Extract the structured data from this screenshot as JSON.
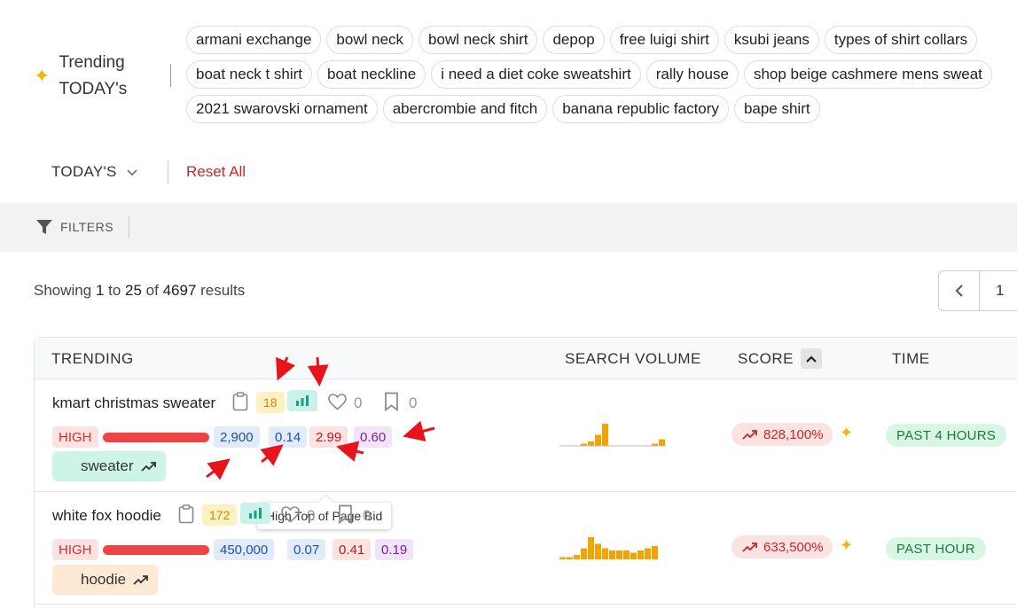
{
  "trending_today": {
    "title_line1": "Trending",
    "title_line2": "TODAY's",
    "chips": [
      [
        "armani exchange",
        "bowl neck",
        "bowl neck shirt",
        "depop",
        "free luigi shirt",
        "ksubi jeans",
        "types of shirt collars"
      ],
      [
        "boat neck t shirt",
        "boat neckline",
        "i need a diet coke sweatshirt",
        "rally house",
        "shop beige cashmere mens sweat"
      ],
      [
        "2021 swarovski ornament",
        "abercrombie and fitch",
        "banana republic factory",
        "bape shirt"
      ]
    ]
  },
  "period_select": {
    "label": "TODAY'S"
  },
  "reset_label": "Reset All",
  "filters_label": "FILTERS",
  "results": {
    "prefix": "Showing ",
    "from": "1",
    "mid1": " to ",
    "to": "25",
    "mid2": " of ",
    "total": "4697",
    "suffix": " results"
  },
  "pagination": {
    "current_page": "1"
  },
  "table": {
    "headers": {
      "trending": "TRENDING",
      "search_volume": "SEARCH VOLUME",
      "score": "SCORE",
      "time": "TIME"
    },
    "rows": [
      {
        "keyword": "kmart christmas sweater",
        "rank_badge": "18",
        "likes": "0",
        "saves": "0",
        "competition": "HIGH",
        "competition_level": 1.0,
        "volume": "2,900",
        "cpc_low": "0.14",
        "cpc_high": "2.99",
        "extra": "0.60",
        "tag": "sweater",
        "tag_color": "#cdf4e8",
        "score": "828,100%",
        "time": "PAST 4 HOURS",
        "spark_values": [
          0,
          0,
          0,
          1,
          2,
          5,
          10,
          0,
          0,
          0,
          0,
          0,
          0,
          1,
          3
        ]
      },
      {
        "keyword": "white fox hoodie",
        "rank_badge": "172",
        "likes": "0",
        "saves": "0",
        "competition": "HIGH",
        "competition_level": 1.0,
        "volume": "450,000",
        "cpc_low": "0.07",
        "cpc_high": "0.41",
        "extra": "0.19",
        "tag": "hoodie",
        "tag_color": "#fde9d4",
        "score": "633,500%",
        "time": "PAST HOUR",
        "spark_values": [
          1,
          1,
          2,
          5,
          10,
          7,
          5,
          4,
          4,
          4,
          3,
          4,
          5,
          6,
          0
        ]
      }
    ],
    "tooltip": "High Top of Page Bid"
  },
  "colors": {
    "accent_red": "#c62828",
    "bar_red": "#ef4444",
    "spark_orange": "#f5a300",
    "sparkle_gold": "#f5b50a"
  }
}
